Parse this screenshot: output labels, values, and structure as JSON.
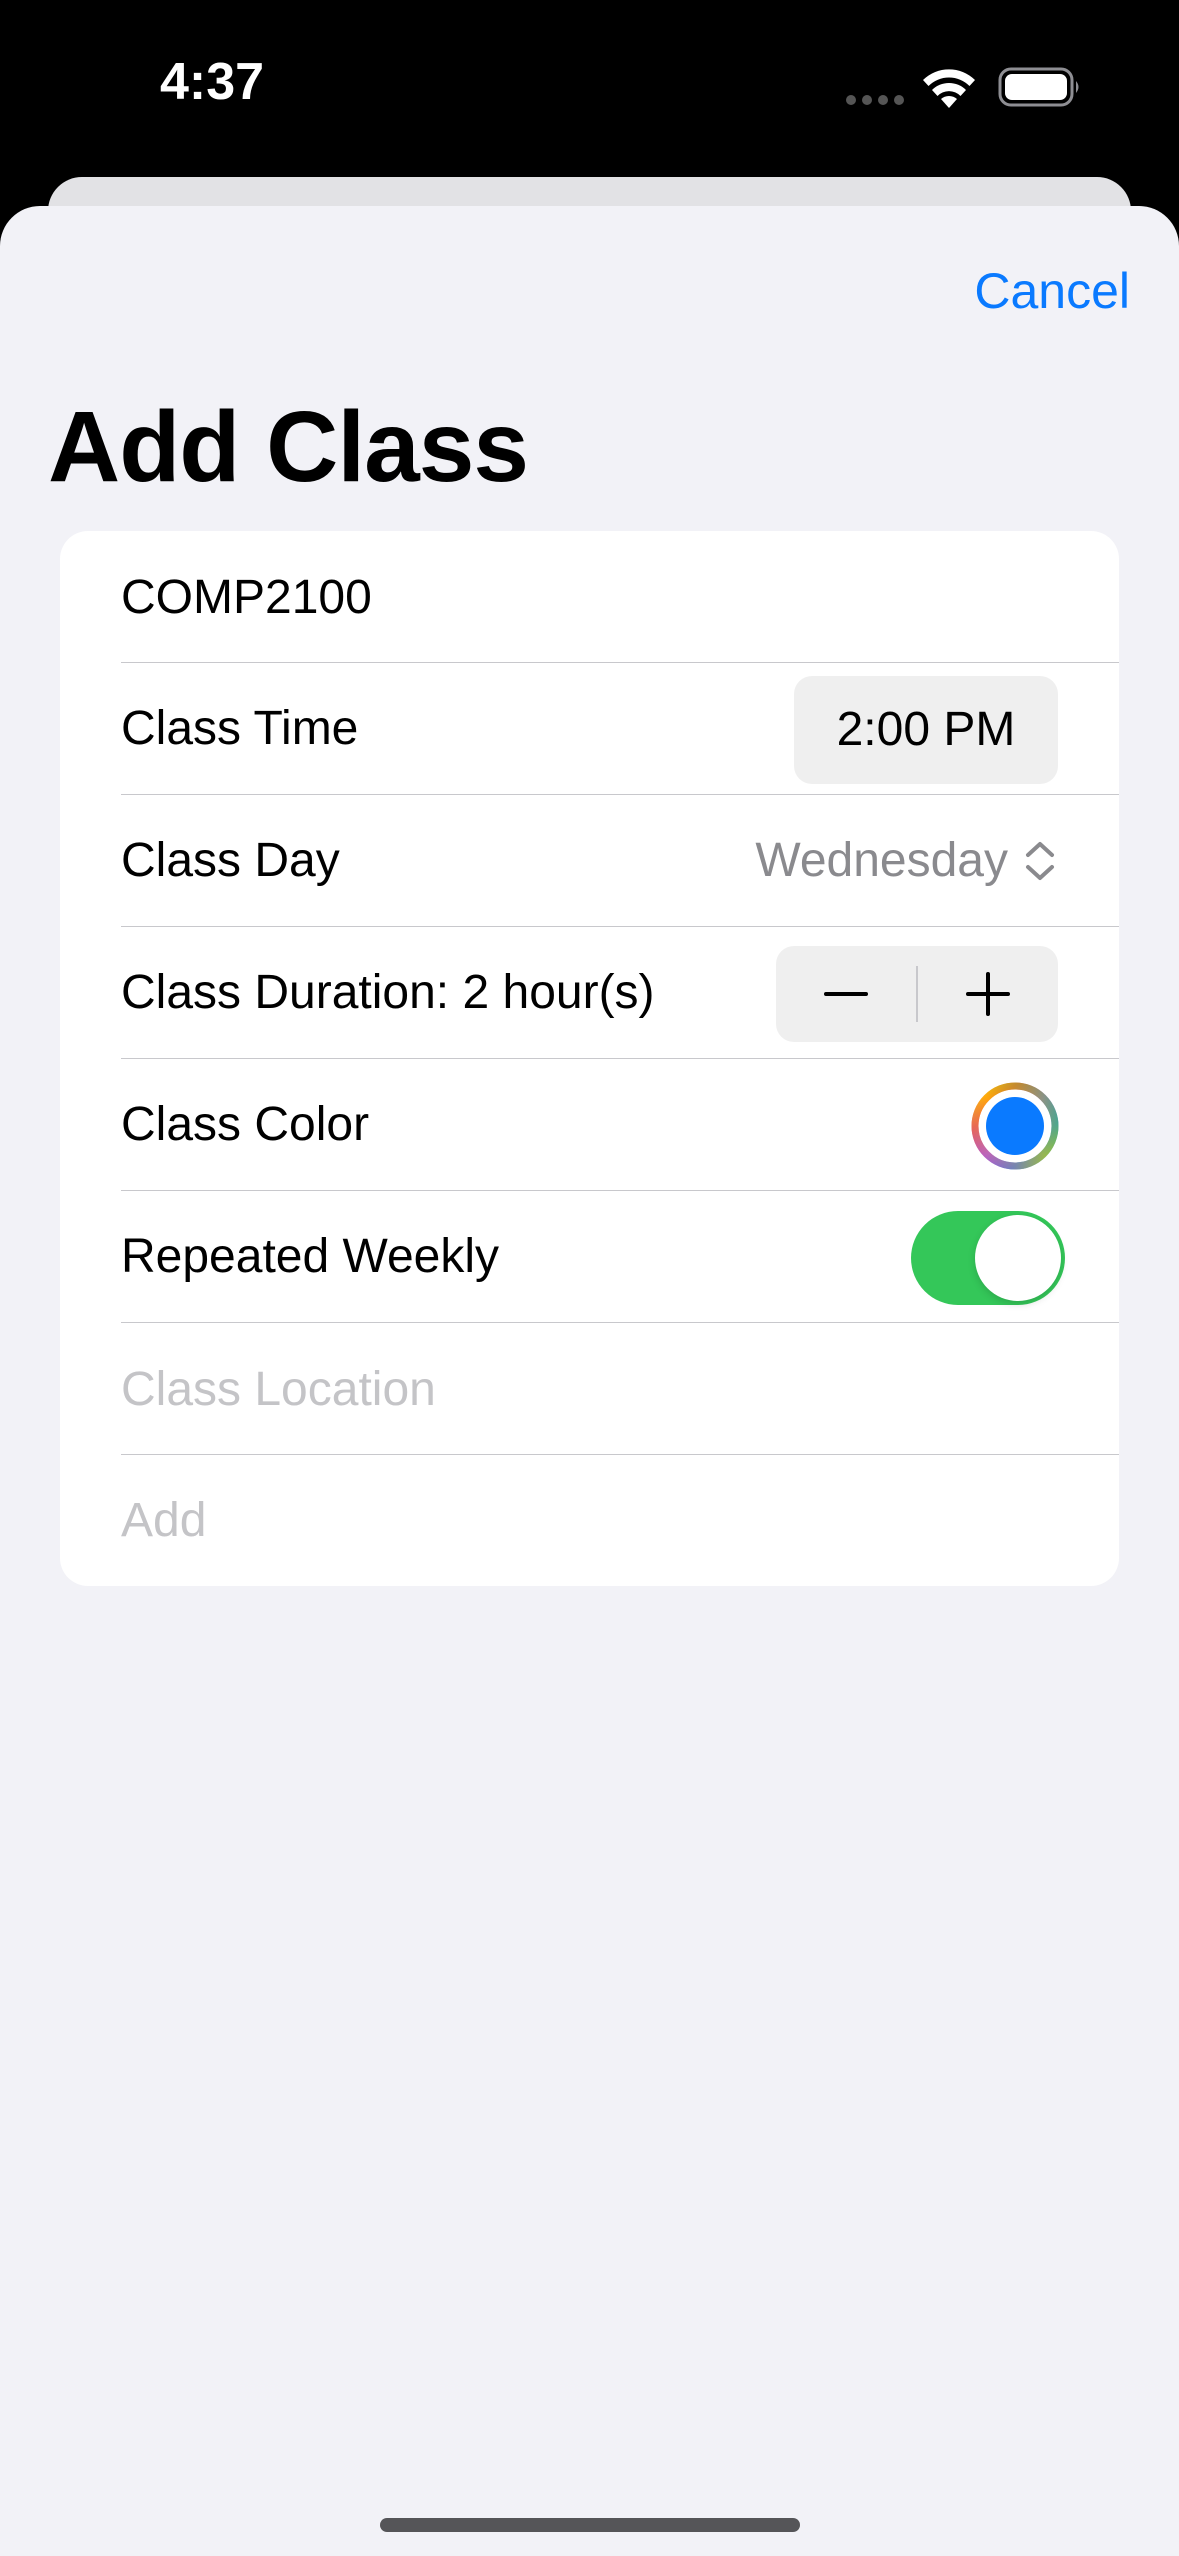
{
  "status_bar": {
    "time": "4:37"
  },
  "header": {
    "cancel_label": "Cancel",
    "title": "Add Class"
  },
  "form": {
    "class_name": {
      "value": "COMP2100"
    },
    "class_time": {
      "label": "Class Time",
      "value": "2:00 PM"
    },
    "class_day": {
      "label": "Class Day",
      "value": "Wednesday",
      "icon": "chevron-up-down-icon"
    },
    "class_duration": {
      "label": "Class Duration: 2 hour(s)",
      "value_hours": 2
    },
    "class_color": {
      "label": "Class Color",
      "value": "#0a7aff"
    },
    "repeated_weekly": {
      "label": "Repeated Weekly",
      "on": true
    },
    "class_location": {
      "placeholder": "Class Location",
      "value": ""
    },
    "add": {
      "label": "Add"
    }
  },
  "colors": {
    "accent": "#0a7aff",
    "toggle_on": "#34c759",
    "sheet_background": "#f2f2f7"
  }
}
